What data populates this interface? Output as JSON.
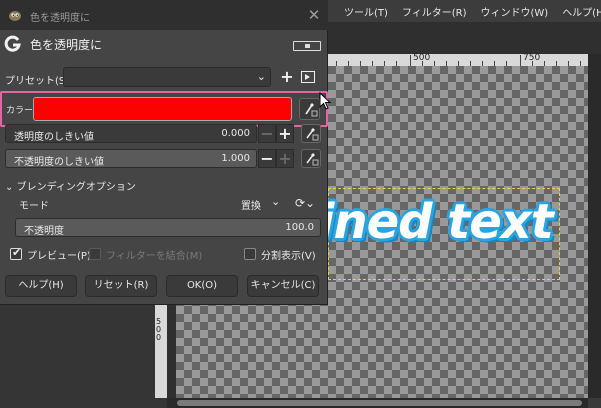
{
  "app": {
    "menubar": [
      "ツール(T)",
      "フィルター(R)",
      "ウィンドウ(W)",
      "ヘルプ(H)"
    ],
    "ruler_labels": [
      "500",
      "750"
    ],
    "vertical_ruler_label": "500",
    "canvas_text": "ined text",
    "canvas_text_outline_color": "#2aa4e0"
  },
  "dialog": {
    "window_title": "色を透明度に",
    "title": "色を透明度に",
    "preset_label": "プリセット(S):",
    "preset_value": "",
    "color_label": "カラー",
    "color_value": "#ff0000",
    "transparency_threshold": {
      "label": "透明度のしきい値",
      "value": "0.000",
      "fraction": 0.0
    },
    "opacity_threshold": {
      "label": "不透明度のしきい値",
      "value": "1.000",
      "fraction": 1.0
    },
    "blending_header": "ブレンディングオプション",
    "mode_label": "モード",
    "mode_value": "置換",
    "opacity": {
      "label": "不透明度",
      "value": "100.0",
      "fraction": 1.0
    },
    "preview_label": "プレビュー(P)",
    "preview_checked": true,
    "merge_filter_label": "フィルターを結合(M)",
    "split_view_label": "分割表示(V)",
    "buttons": {
      "help": "ヘルプ(H)",
      "reset": "リセット(R)",
      "ok": "OK(O)",
      "cancel": "キャンセル(C)"
    }
  }
}
